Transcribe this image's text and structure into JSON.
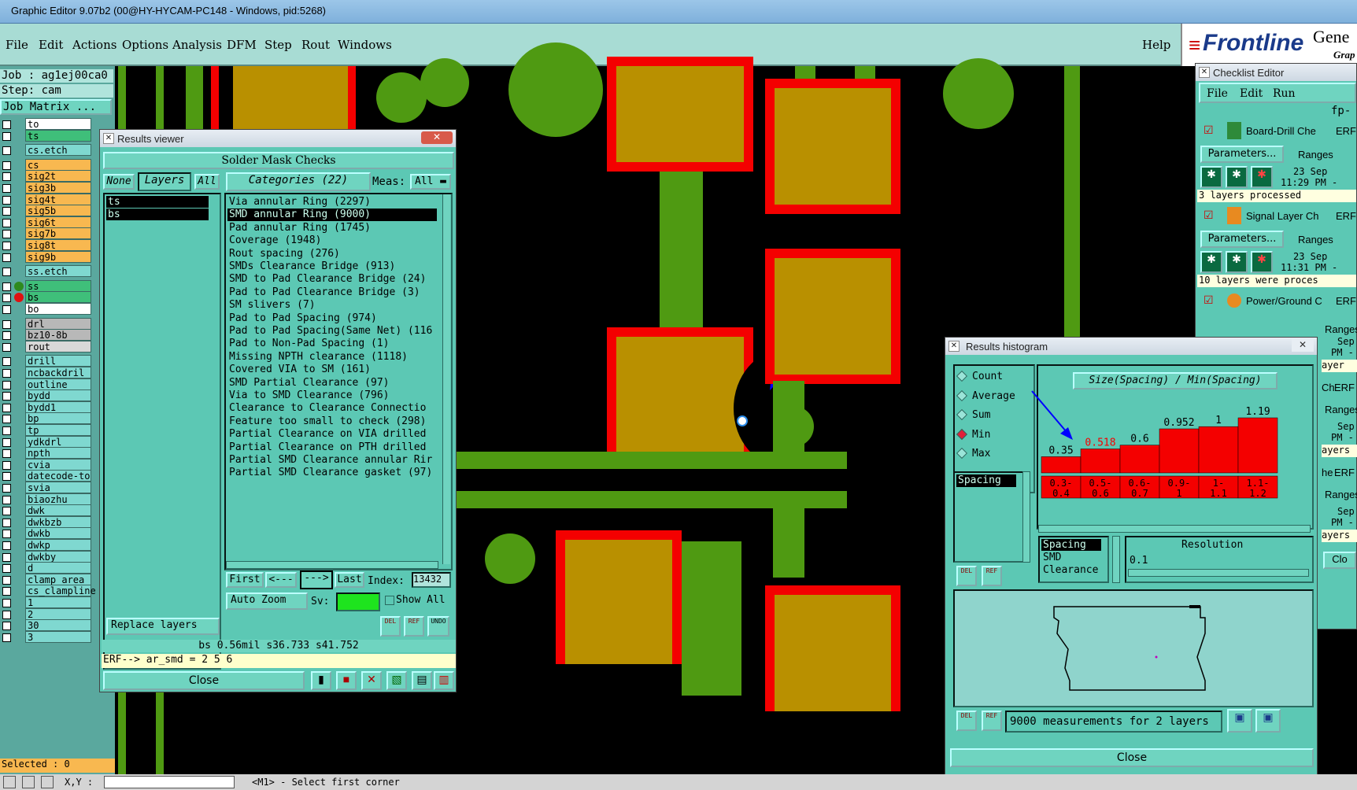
{
  "window_title": "Graphic Editor 9.07b2 (00@HY-HYCAM-PC148 - Windows, pid:5268)",
  "menu": {
    "items": [
      "File",
      "Edit",
      "Actions",
      "Options",
      "Analysis",
      "DFM",
      "Step",
      "Rout",
      "Windows"
    ],
    "help": "Help"
  },
  "brand": {
    "logo": "Frontline",
    "partial_word": "Gene",
    "sub": "Grap"
  },
  "left": {
    "job": "Job : ag1ej00ca0",
    "step": "Step: cam",
    "job_matrix": "Job Matrix ...",
    "selected": "Selected : 0",
    "layers": [
      {
        "name": "to",
        "color": "#ffffff"
      },
      {
        "name": "ts",
        "color": "#3fbf7a"
      },
      {
        "name": "cs.etch",
        "color": "#7fd8d0"
      },
      {
        "name": "cs",
        "color": "#f8b850"
      },
      {
        "name": "sig2t",
        "color": "#f8b850"
      },
      {
        "name": "sig3b",
        "color": "#f8b850"
      },
      {
        "name": "sig4t",
        "color": "#f8b850"
      },
      {
        "name": "sig5b",
        "color": "#f8b850"
      },
      {
        "name": "sig6t",
        "color": "#f8b850"
      },
      {
        "name": "sig7b",
        "color": "#f8b850"
      },
      {
        "name": "sig8t",
        "color": "#f8b850"
      },
      {
        "name": "sig9b",
        "color": "#f8b850"
      },
      {
        "name": "ss.etch",
        "color": "#7fd8d0"
      },
      {
        "name": "ss",
        "color": "#3fbf7a"
      },
      {
        "name": "bs",
        "color": "#3fbf7a"
      },
      {
        "name": "bo",
        "color": "#ffffff"
      },
      {
        "name": "drl",
        "color": "#b8b8b8"
      },
      {
        "name": "bz10-8b",
        "color": "#b8b8b8"
      },
      {
        "name": "rout",
        "color": "#d8d8d8"
      },
      {
        "name": "drill",
        "color": "#7fd8d0"
      },
      {
        "name": "ncbackdril",
        "color": "#7fd8d0"
      },
      {
        "name": "outline",
        "color": "#7fd8d0"
      },
      {
        "name": "bydd",
        "color": "#7fd8d0"
      },
      {
        "name": "bydd1",
        "color": "#7fd8d0"
      },
      {
        "name": "bp",
        "color": "#7fd8d0"
      },
      {
        "name": "tp",
        "color": "#7fd8d0"
      },
      {
        "name": "ydkdrl",
        "color": "#7fd8d0"
      },
      {
        "name": "npth",
        "color": "#7fd8d0"
      },
      {
        "name": "cvia",
        "color": "#7fd8d0"
      },
      {
        "name": "datecode-to",
        "color": "#7fd8d0"
      },
      {
        "name": "svia",
        "color": "#7fd8d0"
      },
      {
        "name": "biaozhu",
        "color": "#7fd8d0"
      },
      {
        "name": "dwk",
        "color": "#7fd8d0"
      },
      {
        "name": "dwkbzb",
        "color": "#7fd8d0"
      },
      {
        "name": "dwkb",
        "color": "#7fd8d0"
      },
      {
        "name": "dwkp",
        "color": "#7fd8d0"
      },
      {
        "name": "dwkby",
        "color": "#7fd8d0"
      },
      {
        "name": "d",
        "color": "#7fd8d0"
      },
      {
        "name": "clamp_area",
        "color": "#7fd8d0"
      },
      {
        "name": "cs_clampline",
        "color": "#7fd8d0"
      },
      {
        "name": "1",
        "color": "#7fd8d0"
      },
      {
        "name": "2",
        "color": "#7fd8d0"
      },
      {
        "name": "30",
        "color": "#7fd8d0"
      },
      {
        "name": "3",
        "color": "#7fd8d0"
      }
    ]
  },
  "results_viewer": {
    "title": "Results viewer",
    "header": "Solder Mask Checks",
    "none": "None",
    "layers_btn": "Layers",
    "all": "All",
    "layers_list": [
      "ts",
      "bs"
    ],
    "categories_btn": "Categories (22)",
    "meas_label": "Meas:",
    "meas_value": "All",
    "categories": [
      "Via annular Ring (2297)",
      "SMD annular Ring (9000)",
      "Pad annular Ring (1745)",
      "Coverage (1948)",
      "Rout spacing (276)",
      "SMDs Clearance Bridge (913)",
      "SMD to Pad Clearance Bridge (24)",
      "Pad to Pad Clearance Bridge (3)",
      "SM slivers (7)",
      "Pad to Pad Spacing (974)",
      "Pad to Pad Spacing(Same Net) (116",
      "Pad to Non-Pad Spacing (1)",
      "Missing NPTH clearance (1118)",
      "Covered VIA to SM (161)",
      "SMD Partial Clearance (97)",
      "Via to SMD Clearance (796)",
      "Clearance to Clearance Connectio",
      "Feature too small to check (298)",
      "Partial Clearance on VIA drilled",
      "Partial Clearance on PTH drilled",
      "Partial SMD Clearance annular Rir",
      "Partial SMD Clearance gasket (97)"
    ],
    "selected_category": "SMD annular Ring (9000)",
    "nav": {
      "first": "First",
      "prev": "<---",
      "next": "--->",
      "last": "Last",
      "index_label": "Index:",
      "index_value": "13432"
    },
    "auto_zoom": "Auto Zoom",
    "sv_label": "Sv:",
    "show_all": "Show All",
    "replace_layers": "Replace layers",
    "status": "bs 0.56mil   s36.733   s41.752",
    "erf": "ERF--> ar_smd = 2 5 6",
    "close": "Close",
    "del": "DEL",
    "ref": "REF",
    "undo": "UNDO"
  },
  "checklist": {
    "title": "Checklist Editor",
    "menu": [
      "File",
      "Edit",
      "Run"
    ],
    "fp": "fp-c",
    "items": [
      {
        "name": "Board-Drill Che",
        "erf": "ERF",
        "params": "Parameters...",
        "ranges": "Ranges",
        "date": "23 Sep",
        "time": "11:29 PM -",
        "status": "3 layers processed"
      },
      {
        "name": "Signal Layer Ch",
        "erf": "ERF",
        "params": "Parameters...",
        "ranges": "Ranges",
        "date": "23 Sep",
        "time": "11:31 PM -",
        "status": "10 layers were proces"
      },
      {
        "name": "Power/Ground C",
        "erf": "ERF"
      }
    ],
    "side_fragments": [
      "Ranges",
      "Sep",
      "PM -",
      "ayer",
      "Ch",
      "ERF",
      "Ranges",
      "Sep",
      "PM -",
      "ayers",
      "he",
      "ERF",
      "Ranges",
      "Sep",
      "PM -",
      "ayers",
      "Clo"
    ]
  },
  "histogram": {
    "title": "Results histogram",
    "modes": [
      "Count",
      "Average",
      "Sum",
      "Min",
      "Max"
    ],
    "selected_mode": "Min",
    "chart_title": "Size(Spacing) / Min(Spacing)",
    "measure_list": [
      "Spacing"
    ],
    "list2": [
      "Spacing",
      "SMD",
      "Clearance"
    ],
    "resolution_label": "Resolution",
    "resolution_value": "0.1",
    "footer": "9000 measurements for 2 layers",
    "close": "Close",
    "del": "DEL",
    "ref": "REF",
    "bar_color": "#f40000",
    "highlight_label_color": "#f40000"
  },
  "chart_data": {
    "type": "bar",
    "title": "Size(Spacing) / Min(Spacing)",
    "categories": [
      "0.3-\n0.4",
      "0.5-\n0.6",
      "0.6-\n0.7",
      "0.9-\n1",
      "1-\n1.1",
      "1.1-\n1.2"
    ],
    "values": [
      0.35,
      0.518,
      0.6,
      0.952,
      1,
      1.19
    ],
    "value_labels": [
      "0.35",
      "0.518",
      "0.6",
      "0.952",
      "1",
      "1.19"
    ],
    "highlight_index": 1
  },
  "status_bar": {
    "prompt": "<M1> - Select first corner",
    "xy": "X,Y :"
  }
}
